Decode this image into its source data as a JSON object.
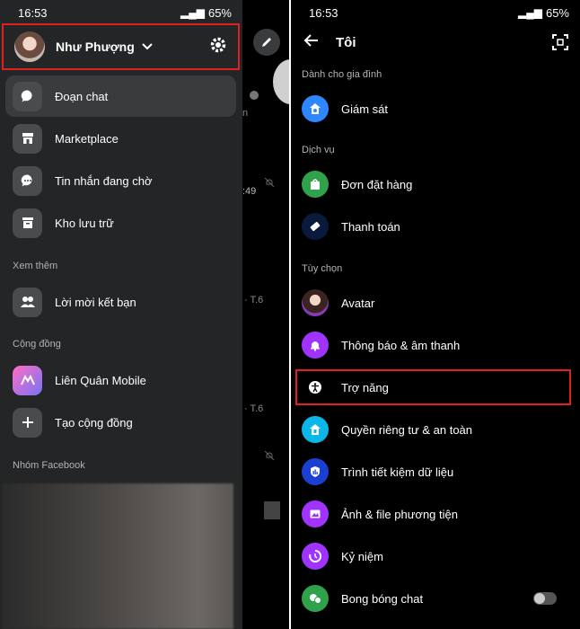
{
  "left_screen": {
    "status": {
      "time": "16:53",
      "battery": "65%"
    },
    "profile": {
      "name": "Như Phượng"
    },
    "menu": [
      {
        "label": "Đoạn chat",
        "icon": "chat-bubble-icon",
        "active": true
      },
      {
        "label": "Marketplace",
        "icon": "store-icon",
        "active": false
      },
      {
        "label": "Tin nhắn đang chờ",
        "icon": "message-pending-icon",
        "active": false
      },
      {
        "label": "Kho lưu trữ",
        "icon": "archive-icon",
        "active": false
      }
    ],
    "section_see_more": "Xem thêm",
    "see_more_items": [
      {
        "label": "Lời mời kết bạn",
        "icon": "friends-icon"
      }
    ],
    "section_community": "Cộng đồng",
    "community_items": [
      {
        "label": "Liên Quân Mobile",
        "icon": "community-avatar-icon"
      },
      {
        "label": "Tạo cộng đồng",
        "icon": "plus-icon"
      }
    ],
    "section_facebook_groups": "Nhóm Facebook",
    "bg_fragments": {
      "chat_time": ":49",
      "day_1": "· T.6",
      "day_2": "· T.6",
      "letter_n": "n"
    }
  },
  "right_screen": {
    "status": {
      "time": "16:53",
      "battery": "65%"
    },
    "header": {
      "title": "Tôi"
    },
    "section_family": "Dành cho gia đình",
    "family_items": [
      {
        "label": "Giám sát",
        "icon": "supervision-icon",
        "color": "#2d88ff"
      }
    ],
    "section_services": "Dịch vụ",
    "service_items": [
      {
        "label": "Đơn đặt hàng",
        "icon": "shopping-bag-icon",
        "color": "#31a24c"
      },
      {
        "label": "Thanh toán",
        "icon": "payment-icon",
        "color": "#0a1a3c"
      }
    ],
    "section_options": "Tùy chọn",
    "option_items": [
      {
        "label": "Avatar",
        "icon": "avatar-icon",
        "color": "#8a3ab9"
      },
      {
        "label": "Thông báo & âm thanh",
        "icon": "bell-icon",
        "color": "#a033ff"
      },
      {
        "label": "Trợ năng",
        "icon": "accessibility-icon",
        "color": "#000000"
      },
      {
        "label": "Quyền riêng tư & an toàn",
        "icon": "privacy-home-icon",
        "color": "#0ab7e8"
      },
      {
        "label": "Trình tiết kiệm dữ liệu",
        "icon": "data-saver-icon",
        "color": "#1b3fd1"
      },
      {
        "label": "Ảnh & file phương tiện",
        "icon": "photo-icon",
        "color": "#a033ff"
      },
      {
        "label": "Kỷ niệm",
        "icon": "memories-icon",
        "color": "#a033ff"
      },
      {
        "label": "Bong bóng chat",
        "icon": "chat-heads-icon",
        "color": "#31a24c"
      }
    ]
  },
  "colors": {
    "highlight": "#e02020",
    "drawer_bg": "#242526",
    "active_item": "#3a3b3c"
  }
}
